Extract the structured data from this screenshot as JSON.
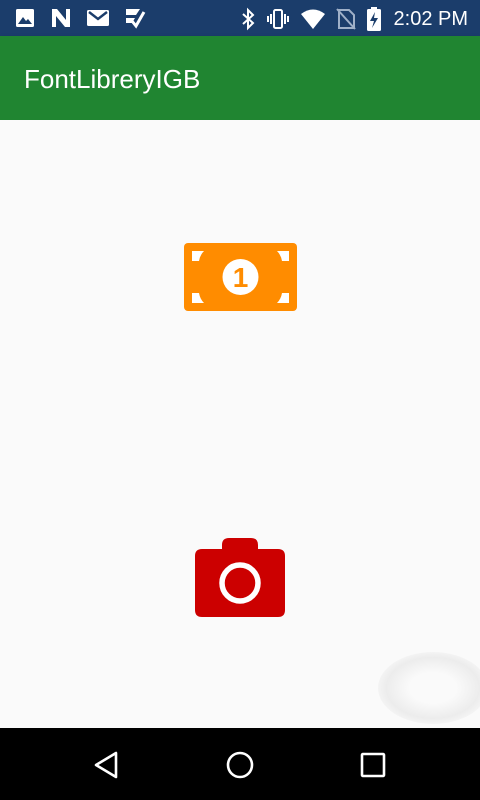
{
  "status_bar": {
    "background": "#1b3d6b",
    "left_icons": [
      "image-icon",
      "n-icon",
      "gmail-icon",
      "task-icon"
    ],
    "right_icons": [
      "bluetooth-icon",
      "vibrate-icon",
      "wifi-icon",
      "no-sim-icon",
      "battery-charging-icon"
    ],
    "time": "2:02 PM"
  },
  "app_bar": {
    "title": "FontLibreryIGB",
    "background": "#208531"
  },
  "content": {
    "icons": [
      {
        "name": "money-bill-icon",
        "color": "#ff8c00",
        "denomination": "1"
      },
      {
        "name": "camera-icon",
        "color": "#cc0000"
      }
    ]
  },
  "nav_bar": {
    "buttons": [
      "back-button",
      "home-button",
      "recents-button"
    ]
  }
}
